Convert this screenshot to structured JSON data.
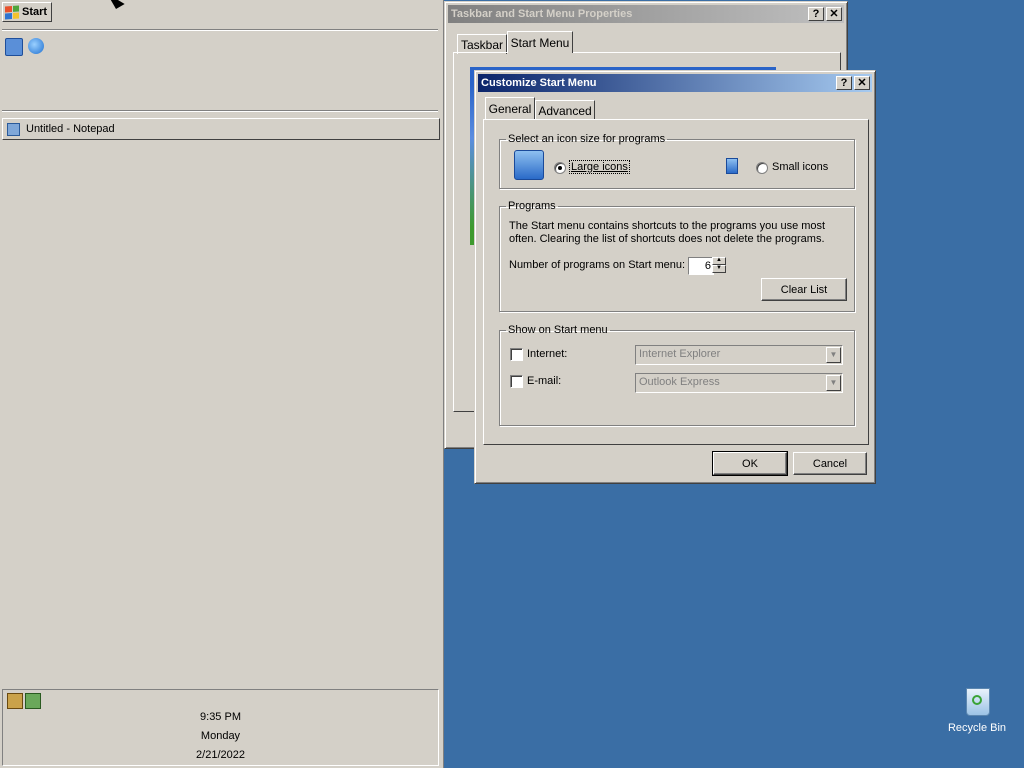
{
  "colors": {
    "desktop": "#3a6ea5",
    "face": "#d4d0c8",
    "title_active": "#0a246a",
    "title_inactive": "#808080"
  },
  "taskbar": {
    "start_label": "Start",
    "quick_launch": [
      "show-desktop-icon",
      "internet-explorer-icon"
    ],
    "tasks": [
      {
        "label": "Untitled - Notepad",
        "icon": "notepad-icon"
      }
    ],
    "tray": {
      "time": "9:35 PM",
      "day": "Monday",
      "date": "2/21/2022"
    }
  },
  "back_window": {
    "title": "Taskbar and Start Menu Properties",
    "tabs": [
      "Taskbar",
      "Start Menu"
    ],
    "active_tab": "Start Menu"
  },
  "dialog": {
    "title": "Customize Start Menu",
    "help_button": "?",
    "close_button": "✕",
    "tabs": [
      "General",
      "Advanced"
    ],
    "active_tab": "General",
    "icon_size": {
      "legend": "Select an icon size for programs",
      "large_label": "Large icons",
      "small_label": "Small icons",
      "selected": "Large icons"
    },
    "programs": {
      "legend": "Programs",
      "description": "The Start menu contains shortcuts to the programs you use most often. Clearing the list of shortcuts does not delete the programs.",
      "count_label": "Number of programs on Start menu:",
      "count_value": "6",
      "clear_button": "Clear List"
    },
    "show": {
      "legend": "Show on Start menu",
      "internet_label": "Internet:",
      "internet_value": "Internet Explorer",
      "email_label": "E-mail:",
      "email_value": "Outlook Express"
    },
    "ok_button": "OK",
    "cancel_button": "Cancel"
  },
  "desktop": {
    "recycle_bin_label": "Recycle Bin"
  }
}
